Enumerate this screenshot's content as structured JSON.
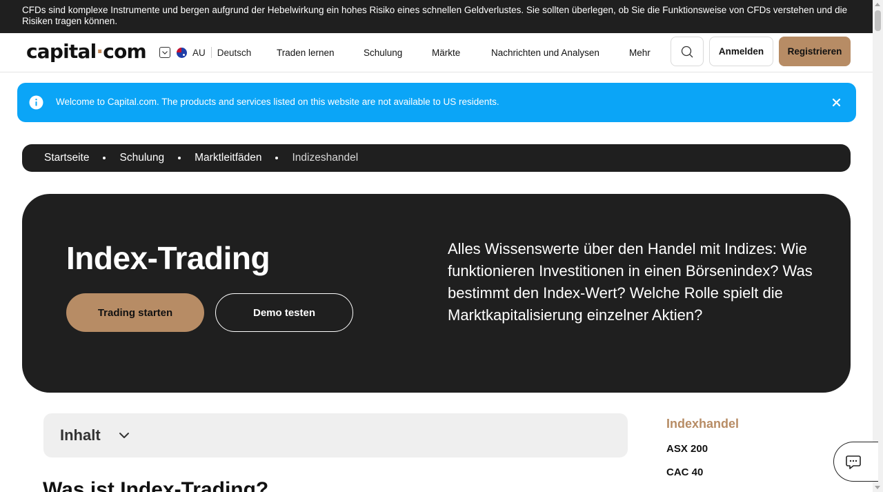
{
  "risk_warning": "CFDs sind komplexe Instrumente und bergen aufgrund der Hebelwirkung ein hohes Risiko eines schnellen Geldverlustes. Sie sollten überlegen, ob Sie die Funktionsweise von CFDs verstehen und die Risiken tragen können.",
  "header": {
    "logo_left": "capital",
    "logo_dot": "·",
    "logo_right": "com",
    "region_code": "AU",
    "language": "Deutsch",
    "nav": [
      "Traden lernen",
      "Schulung",
      "Märkte",
      "Nachrichten und Analysen",
      "Mehr"
    ],
    "login": "Anmelden",
    "register": "Registrieren"
  },
  "alert": {
    "text": "Welcome to Capital.com. The products and services listed on this website are not available to US residents."
  },
  "breadcrumb": {
    "items": [
      "Startseite",
      "Schulung",
      "Marktleitfäden"
    ],
    "current": "Indizeshandel"
  },
  "hero": {
    "title": "Index-Trading",
    "primary_cta": "Trading starten",
    "secondary_cta": "Demo testen",
    "description": "Alles Wissenswerte über den Handel mit Indizes: Wie funktionieren Investitionen in einen Börsenindex? Was bestimmt den Index-Wert? Welche Rolle spielt die Marktkapitalisierung einzelner Aktien?"
  },
  "toc": {
    "label": "Inhalt"
  },
  "article": {
    "heading": "Was ist Index-Trading?"
  },
  "sidebar": {
    "title": "Indexhandel",
    "links": [
      "ASX 200",
      "CAC 40"
    ]
  },
  "colors": {
    "accent": "#b78c65",
    "dark": "#1f1f1f",
    "alert_blue": "#0ba5f7"
  },
  "icons": {
    "search": "search-icon",
    "info": "info-icon",
    "close": "close-icon",
    "chevron": "chevron-down-icon",
    "chat": "chat-icon",
    "flag": "australia-flag-icon"
  }
}
